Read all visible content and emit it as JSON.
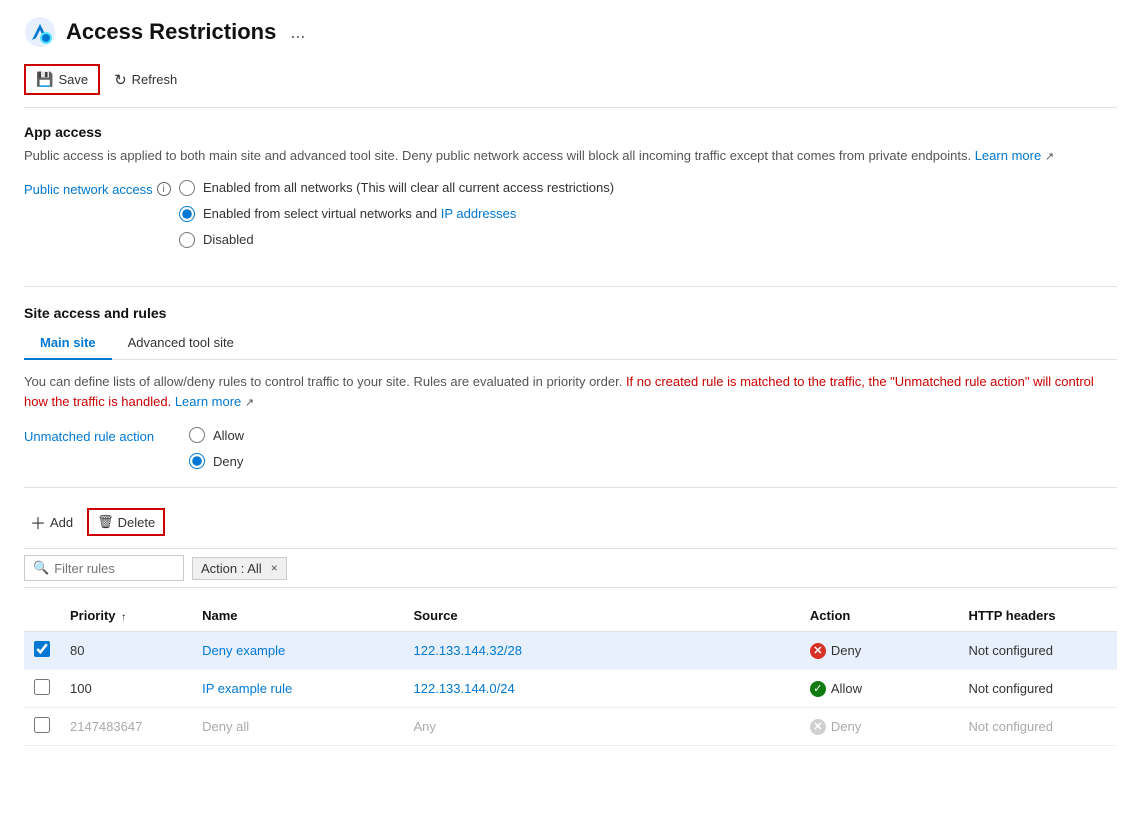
{
  "header": {
    "title": "Access Restrictions",
    "dots_label": "..."
  },
  "toolbar": {
    "save_label": "Save",
    "refresh_label": "Refresh"
  },
  "app_access": {
    "section_title": "App access",
    "description": "Public access is applied to both main site and advanced tool site. Deny public network access will block all incoming traffic except that comes from private endpoints.",
    "learn_more": "Learn more",
    "public_network_label": "Public network access",
    "options": [
      {
        "id": "opt1",
        "label": "Enabled from all networks (This will clear all current access restrictions)",
        "selected": false
      },
      {
        "id": "opt2",
        "label": "Enabled from select virtual networks and IP addresses",
        "selected": true
      },
      {
        "id": "opt3",
        "label": "Disabled",
        "selected": false
      }
    ],
    "link_text": "IP addresses"
  },
  "site_access": {
    "section_title": "Site access and rules",
    "tabs": [
      {
        "id": "main",
        "label": "Main site",
        "active": true
      },
      {
        "id": "advanced",
        "label": "Advanced tool site",
        "active": false
      }
    ],
    "rules_desc_part1": "You can define lists of allow/deny rules to control traffic to your site. Rules are evaluated in priority order.",
    "rules_desc_highlight": "If no created rule is matched to the traffic, the \"Unmatched rule action\" will control how the traffic is handled.",
    "learn_more": "Learn more",
    "unmatched_label": "Unmatched rule action",
    "unmatched_options": [
      {
        "id": "u1",
        "label": "Allow",
        "selected": false
      },
      {
        "id": "u2",
        "label": "Deny",
        "selected": true
      }
    ]
  },
  "rules_toolbar": {
    "add_label": "Add",
    "delete_label": "Delete"
  },
  "filter": {
    "placeholder": "Filter rules",
    "action_tag": "Action : All",
    "close_icon": "×"
  },
  "table": {
    "columns": [
      {
        "id": "checkbox",
        "label": ""
      },
      {
        "id": "priority",
        "label": "Priority"
      },
      {
        "id": "name",
        "label": "Name"
      },
      {
        "id": "source",
        "label": "Source"
      },
      {
        "id": "action",
        "label": "Action"
      },
      {
        "id": "http_headers",
        "label": "HTTP headers"
      }
    ],
    "rows": [
      {
        "selected": true,
        "priority": "80",
        "name": "Deny example",
        "source": "122.133.144.32/28",
        "action": "Deny",
        "action_type": "deny",
        "http_headers": "Not configured"
      },
      {
        "selected": false,
        "priority": "100",
        "name": "IP example rule",
        "source": "122.133.144.0/24",
        "action": "Allow",
        "action_type": "allow",
        "http_headers": "Not configured"
      },
      {
        "selected": false,
        "priority": "2147483647",
        "name": "Deny all",
        "source": "Any",
        "action": "Deny",
        "action_type": "deny-grey",
        "http_headers": "Not configured"
      }
    ]
  }
}
